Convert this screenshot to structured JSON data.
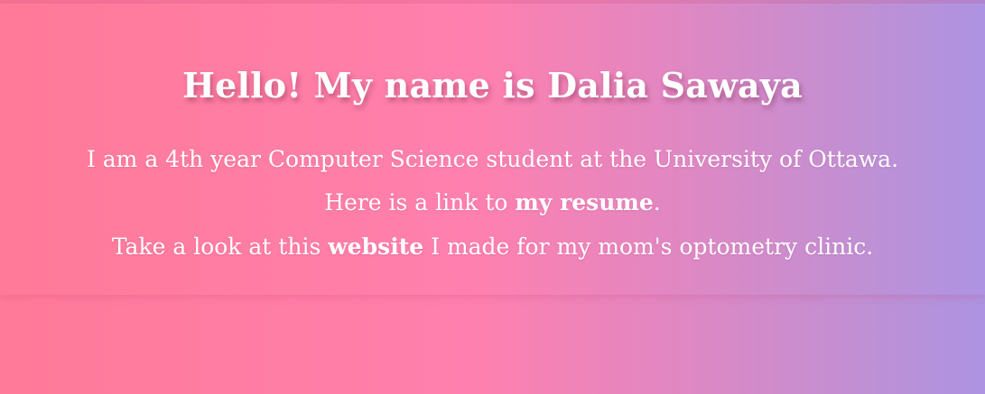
{
  "hero": {
    "title": "Hello! My name is Dalia Sawaya",
    "intro": "I am a 4th year Computer Science student at the University of Ottawa.",
    "resume_prefix": "Here is a link to ",
    "resume_link": "my resume",
    "resume_suffix": ".",
    "website_prefix": "Take a look at this ",
    "website_link": "website",
    "website_suffix": " I made for my mom's optometry clinic."
  },
  "colors": {
    "gradient_start": "#ff7a98",
    "gradient_mid": "#ff80ae",
    "gradient_end": "#ad93e2",
    "text": "#ffffff"
  }
}
